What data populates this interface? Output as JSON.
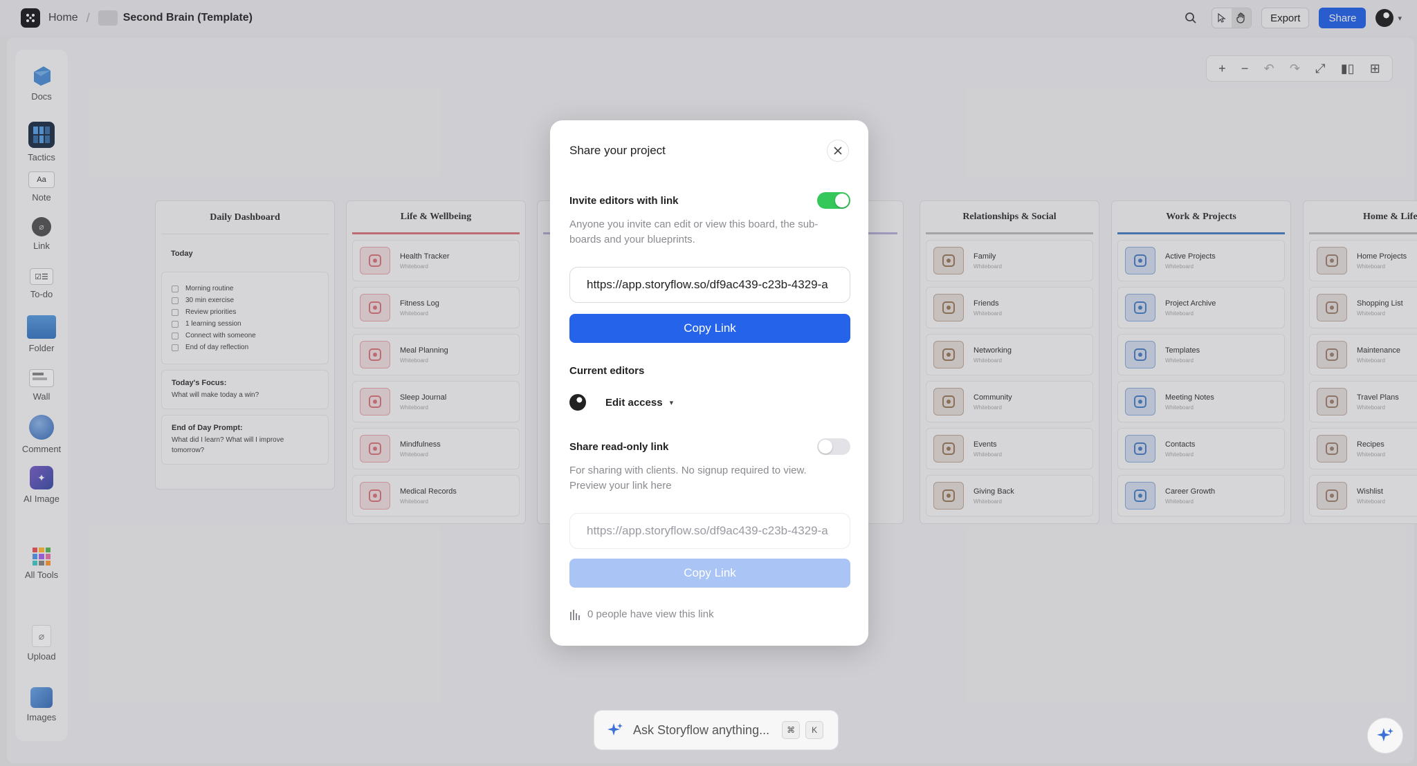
{
  "topbar": {
    "home": "Home",
    "separator": "/",
    "project_title": "Second Brain (Template)",
    "export_label": "Export",
    "share_label": "Share"
  },
  "tools": [
    {
      "label": "Docs"
    },
    {
      "label": "Tactics"
    },
    {
      "label": "Note",
      "icon_text": "Aa"
    },
    {
      "label": "Link"
    },
    {
      "label": "To-do"
    },
    {
      "label": "Folder"
    },
    {
      "label": "Wall"
    },
    {
      "label": "Comment"
    },
    {
      "label": "AI Image"
    },
    {
      "label": "All Tools"
    },
    {
      "label": "Upload"
    },
    {
      "label": "Images"
    }
  ],
  "daily_dashboard": {
    "title": "Daily Dashboard",
    "today_label": "Today",
    "checklist": [
      "Morning routine",
      "30 min exercise",
      "Review priorities",
      "1 learning session",
      "Connect with someone",
      "End of day reflection"
    ],
    "focus_title": "Today's Focus:",
    "focus_text": "What will make today a win?",
    "eod_title": "End of Day Prompt:",
    "eod_text": "What did I learn? What will I improve tomorrow?"
  },
  "boards": {
    "life": {
      "title": "Life & Wellbeing",
      "items": [
        "Health Tracker",
        "Fitness Log",
        "Meal Planning",
        "Sleep Journal",
        "Mindfulness",
        "Medical Records"
      ]
    },
    "relationships": {
      "title": "Relationships & Social",
      "items": [
        "Family",
        "Friends",
        "Networking",
        "Community",
        "Events",
        "Giving Back"
      ]
    },
    "work": {
      "title": "Work & Projects",
      "items": [
        "Active Projects",
        "Project Archive",
        "Templates",
        "Meeting Notes",
        "Contacts",
        "Career Growth"
      ]
    },
    "home": {
      "title": "Home & Lifes",
      "items": [
        "Home Projects",
        "Shopping List",
        "Maintenance",
        "Travel Plans",
        "Recipes",
        "Wishlist"
      ]
    }
  },
  "item_sub": "Whiteboard",
  "modal": {
    "title": "Share your project",
    "invite_label": "Invite editors with link",
    "invite_desc": "Anyone you invite can edit or view this board, the sub-boards and your blueprints.",
    "editor_link": "https://app.storyflow.so/df9ac439-c23b-4329-a",
    "copy_label": "Copy Link",
    "current_editors": "Current editors",
    "edit_access": "Edit access",
    "readonly_label": "Share read-only link",
    "readonly_desc": "For sharing with clients. No signup required to view. Preview your link here",
    "readonly_link": "https://app.storyflow.so/df9ac439-c23b-4329-a",
    "copy_label_2": "Copy Link",
    "views_text": "0 people have view this link"
  },
  "ask": {
    "text": "Ask Storyflow anything...",
    "key1": "⌘",
    "key2": "K"
  },
  "colors": {
    "accent": "#2563eb",
    "toggle_on": "#34c759",
    "life": "#d9777d",
    "relationships": "#9c7a5b",
    "work": "#4b7fc4",
    "home": "#a08270"
  }
}
